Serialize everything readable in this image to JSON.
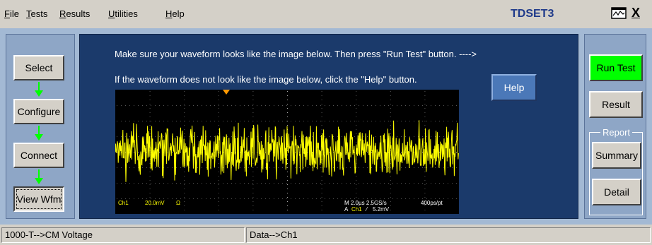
{
  "menu": {
    "file": {
      "accel": "F",
      "rest": "ile"
    },
    "tests": {
      "accel": "T",
      "rest": "ests"
    },
    "results": {
      "accel": "R",
      "rest": "esults"
    },
    "utilities": {
      "accel": "U",
      "rest": "tilities"
    },
    "help": {
      "accel": "H",
      "rest": "elp"
    }
  },
  "app_title": "TDSET3",
  "close_label": "X",
  "left_nav": {
    "select": "Select",
    "configure": "Configure",
    "connect": "Connect",
    "view_wfm": "View Wfm"
  },
  "instructions": {
    "line1": "Make sure your waveform looks like the image below. Then press \"Run Test\" button. ---->",
    "line2": "If the waveform does not look like the image below, click the \"Help\" button."
  },
  "help_button": "Help",
  "scope": {
    "ch_label": "Ch1",
    "scale": "20.0mV",
    "ohm": "Ω",
    "timebase": "M 2.0µs 2.5GS/s",
    "resolution": "400ps/pt",
    "trigger_prefix": "A",
    "trigger_source": "Ch1",
    "trigger_slope": "⁄",
    "trigger_level": "5.2mV"
  },
  "right_panel": {
    "run_test": "Run Test",
    "result": "Result",
    "report_label": "Report",
    "summary": "Summary",
    "detail": "Detail"
  },
  "status": {
    "left": "1000-T-->CM Voltage",
    "right": "Data-->Ch1"
  },
  "colors": {
    "run_test_active": "#00ff00",
    "waveform": "#ffff00",
    "app_title": "#1f3a8a"
  }
}
